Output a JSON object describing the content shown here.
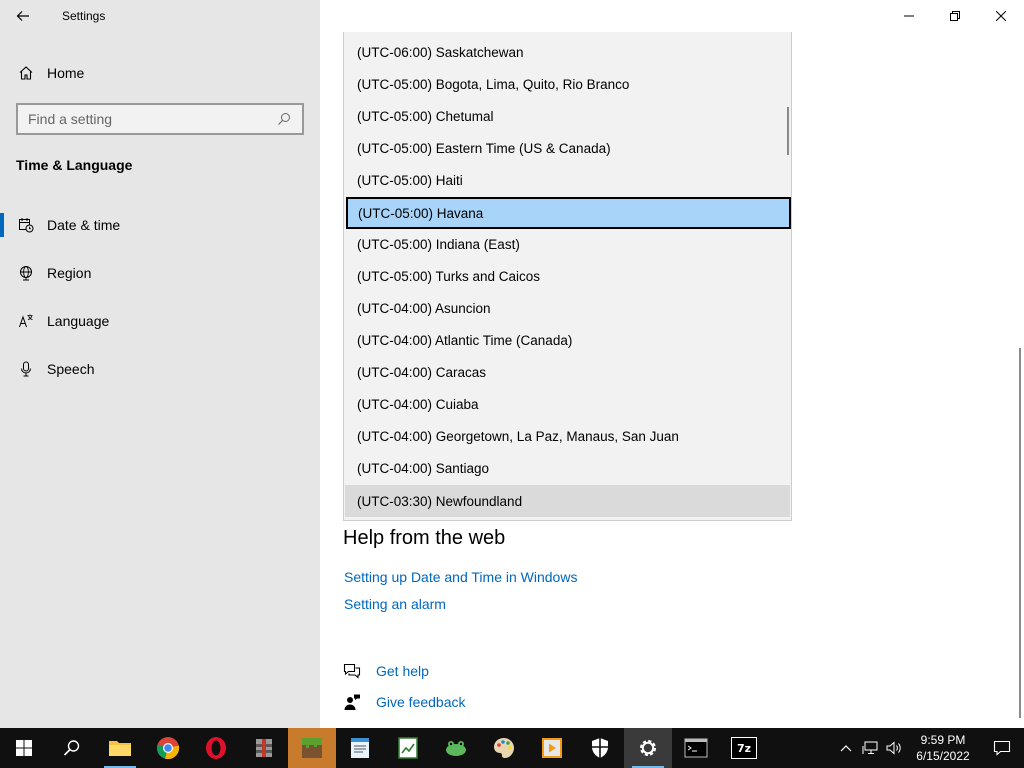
{
  "window": {
    "title": "Settings"
  },
  "sidebar": {
    "home_label": "Home",
    "search_placeholder": "Find a setting",
    "section_title": "Time & Language",
    "items": [
      {
        "label": "Date & time",
        "icon": "date-time-icon",
        "selected": true
      },
      {
        "label": "Region",
        "icon": "globe-icon",
        "selected": false
      },
      {
        "label": "Language",
        "icon": "language-icon",
        "selected": false
      },
      {
        "label": "Speech",
        "icon": "microphone-icon",
        "selected": false
      }
    ]
  },
  "timezone_list": {
    "options": [
      "(UTC-06:00) Saskatchewan",
      "(UTC-05:00) Bogota, Lima, Quito, Rio Branco",
      "(UTC-05:00) Chetumal",
      "(UTC-05:00) Eastern Time (US & Canada)",
      "(UTC-05:00) Haiti",
      "(UTC-05:00) Havana",
      "(UTC-05:00) Indiana (East)",
      "(UTC-05:00) Turks and Caicos",
      "(UTC-04:00) Asuncion",
      "(UTC-04:00) Atlantic Time (Canada)",
      "(UTC-04:00) Caracas",
      "(UTC-04:00) Cuiaba",
      "(UTC-04:00) Georgetown, La Paz, Manaus, San Juan",
      "(UTC-04:00) Santiago",
      "(UTC-03:30) Newfoundland"
    ],
    "selected": "(UTC-05:00) Havana",
    "hovered": "(UTC-03:30) Newfoundland"
  },
  "help": {
    "title": "Help from the web",
    "links": [
      "Setting up Date and Time in Windows",
      "Setting an alarm"
    ]
  },
  "bottom_links": {
    "get_help": "Get help",
    "give_feedback": "Give feedback"
  },
  "taskbar": {
    "time": "9:59 PM",
    "date": "6/15/2022",
    "apps": [
      "start",
      "search",
      "file-explorer",
      "chrome",
      "opera",
      "archiver",
      "minecraft",
      "notepad",
      "spreadsheet",
      "frog-app",
      "paint",
      "media-player",
      "security",
      "settings",
      "terminal",
      "7zip"
    ],
    "label_7zip": "7z"
  },
  "colors": {
    "accent": "#0067c0",
    "sidebar_bg": "#e6e6e6",
    "selected_bg": "#a8d4f9",
    "taskbar_bg": "#101010"
  }
}
